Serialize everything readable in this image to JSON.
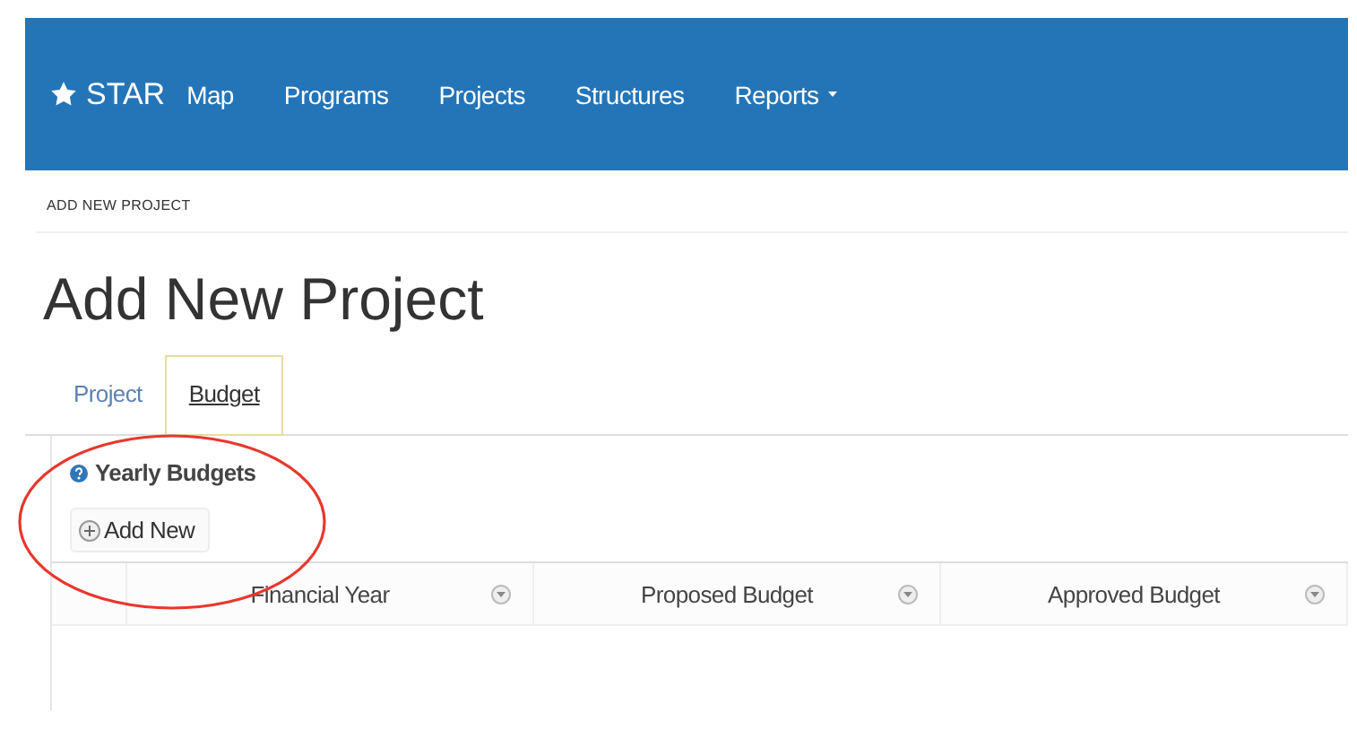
{
  "navbar": {
    "brand": "STAR",
    "items": [
      {
        "label": "Map",
        "dropdown": false
      },
      {
        "label": "Programs",
        "dropdown": false
      },
      {
        "label": "Projects",
        "dropdown": false
      },
      {
        "label": "Structures",
        "dropdown": false
      },
      {
        "label": "Reports",
        "dropdown": true
      }
    ]
  },
  "breadcrumb": "ADD NEW PROJECT",
  "page_title": "Add New Project",
  "tabs": [
    {
      "label": "Project",
      "selected": false
    },
    {
      "label": "Budget",
      "selected": true
    }
  ],
  "section": {
    "title": "Yearly Budgets",
    "add_button": "Add New"
  },
  "table": {
    "columns": [
      {
        "label": "Financial Year"
      },
      {
        "label": "Proposed Budget"
      },
      {
        "label": "Approved Budget"
      }
    ]
  }
}
